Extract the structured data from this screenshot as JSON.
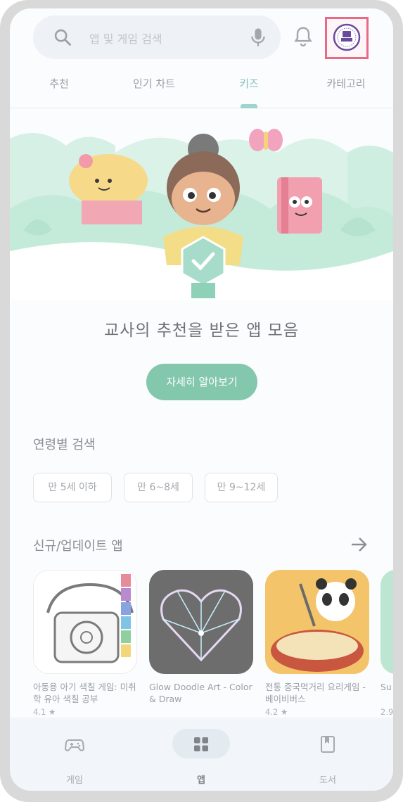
{
  "search": {
    "placeholder": "앱 및 게임 검색"
  },
  "tabs": [
    {
      "label": "추천"
    },
    {
      "label": "인기 차트"
    },
    {
      "label": "키즈"
    },
    {
      "label": "카테고리"
    }
  ],
  "banner": {
    "title": "교사의 추천을 받은 앱 모음",
    "button": "자세히 알아보기"
  },
  "age_search": {
    "title": "연령별 검색",
    "chips": [
      "만 5세 이하",
      "만 6~8세",
      "만 9~12세"
    ]
  },
  "new_apps": {
    "title": "신규/업데이트 앱",
    "apps": [
      {
        "name": "아동용 아기 색칠 게임: 미취학 유아 색칠 공부",
        "rating": "4.1 ★"
      },
      {
        "name": "Glow Doodle Art - Color & Draw",
        "rating": ""
      },
      {
        "name": "전통 중국먹거리 요리게임 - 베이비버스",
        "rating": "4.2 ★"
      },
      {
        "name": "Su",
        "rating": "2.9"
      }
    ]
  },
  "bottom_nav": [
    {
      "label": "게임",
      "icon": "gamepad-icon"
    },
    {
      "label": "앱",
      "icon": "apps-grid-icon"
    },
    {
      "label": "도서",
      "icon": "book-icon"
    }
  ],
  "colors": {
    "accent": "#83c7ad",
    "tab_active": "#7fbfbf",
    "highlight_border": "#ea6a86"
  }
}
